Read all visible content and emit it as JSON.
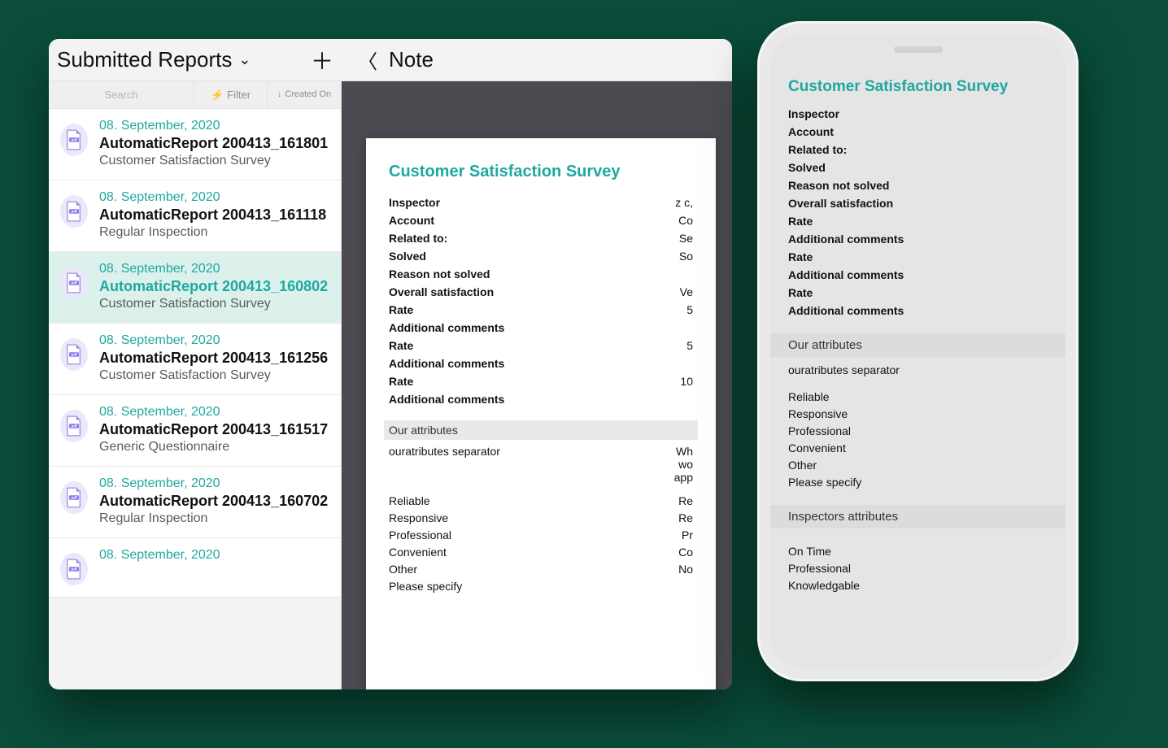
{
  "header": {
    "sidebar_title": "Submitted Reports",
    "note_title": "Note"
  },
  "toolbar": {
    "search_placeholder": "Search",
    "filter_label": "Filter",
    "sort_label": "Created On"
  },
  "reports": [
    {
      "date": "08. September, 2020",
      "name": "AutomaticReport 200413_161801",
      "sub": "Customer Satisfaction Survey",
      "selected": false
    },
    {
      "date": "08. September, 2020",
      "name": "AutomaticReport 200413_161118",
      "sub": "Regular Inspection",
      "selected": false
    },
    {
      "date": "08. September, 2020",
      "name": "AutomaticReport 200413_160802",
      "sub": "Customer Satisfaction Survey",
      "selected": true
    },
    {
      "date": "08. September, 2020",
      "name": "AutomaticReport 200413_161256",
      "sub": "Customer Satisfaction Survey",
      "selected": false
    },
    {
      "date": "08. September, 2020",
      "name": "AutomaticReport 200413_161517",
      "sub": "Generic Questionnaire",
      "selected": false
    },
    {
      "date": "08. September, 2020",
      "name": "AutomaticReport 200413_160702",
      "sub": "Regular Inspection",
      "selected": false
    },
    {
      "date": "08. September, 2020",
      "name": "",
      "sub": "",
      "selected": false
    }
  ],
  "doc": {
    "title": "Customer Satisfaction Survey",
    "fields": [
      {
        "label": "Inspector",
        "value": "z c,"
      },
      {
        "label": "Account",
        "value": "Co"
      },
      {
        "label": "Related to:",
        "value": "Se"
      },
      {
        "label": "Solved",
        "value": "So"
      },
      {
        "label": "Reason not solved",
        "value": ""
      },
      {
        "label": "Overall satisfaction",
        "value": "Ve"
      },
      {
        "label": "Rate",
        "value": "5"
      },
      {
        "label": "Additional comments",
        "value": ""
      },
      {
        "label": "Rate",
        "value": "5"
      },
      {
        "label": "Additional comments",
        "value": ""
      },
      {
        "label": "Rate",
        "value": "10"
      },
      {
        "label": "Additional comments",
        "value": ""
      }
    ],
    "section1_title": "Our attributes",
    "section1_sub": {
      "label": "ouratributes separator",
      "value": "Wh\nwo\napp"
    },
    "attrs": [
      {
        "label": "Reliable",
        "value": "Re"
      },
      {
        "label": "Responsive",
        "value": "Re"
      },
      {
        "label": "Professional",
        "value": "Pr"
      },
      {
        "label": "Convenient",
        "value": "Co"
      },
      {
        "label": "Other",
        "value": "No"
      },
      {
        "label": "Please specify",
        "value": ""
      }
    ]
  },
  "mobile": {
    "title": "Customer Satisfaction Survey",
    "fields": [
      "Inspector",
      "Account",
      "Related to:",
      "Solved",
      "Reason not solved",
      "Overall satisfaction",
      "Rate",
      "Additional comments",
      "Rate",
      "Additional comments",
      "Rate",
      "Additional comments"
    ],
    "section1_title": "Our attributes",
    "section1_sub": "ouratributes separator",
    "attrs": [
      "Reliable",
      "Responsive",
      "Professional",
      "Convenient",
      "Other",
      "Please specify"
    ],
    "section2_title": "Inspectors attributes",
    "attrs2": [
      "On Time",
      "Professional",
      "Knowledgable"
    ]
  }
}
